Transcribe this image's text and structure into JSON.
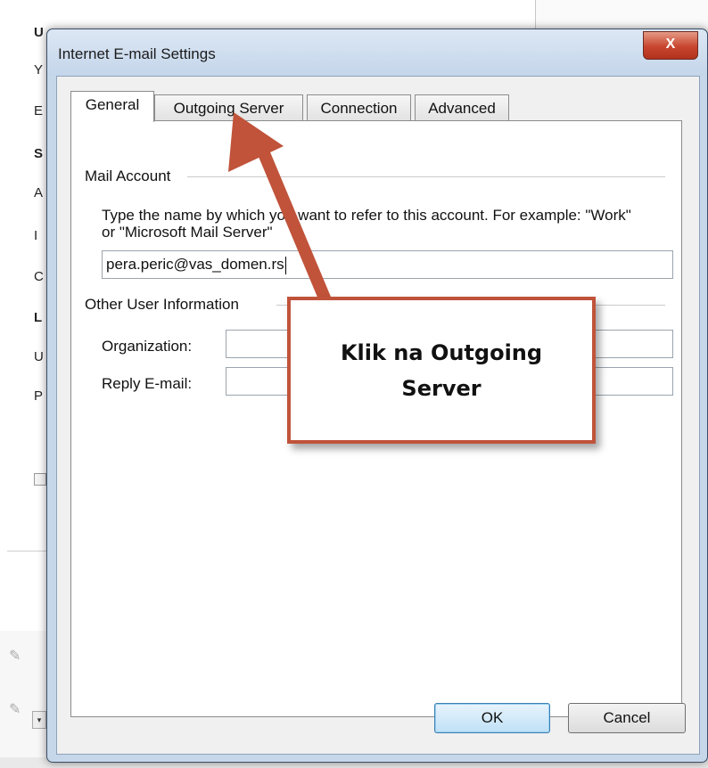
{
  "background_window": {
    "row_initials": [
      "U",
      "Y",
      "E",
      "S",
      "A",
      "I",
      "C",
      "L",
      "U",
      "P"
    ]
  },
  "dialog": {
    "title": "Internet E-mail Settings",
    "close_glyph": "X",
    "tabs": [
      {
        "label": "General",
        "active": true
      },
      {
        "label": "Outgoing Server",
        "active": false
      },
      {
        "label": "Connection",
        "active": false
      },
      {
        "label": "Advanced",
        "active": false
      }
    ],
    "mail_account": {
      "group_label": "Mail Account",
      "description": "Type the name by which you want to refer to this account. For example: \"Work\" or \"Microsoft Mail Server\"",
      "account_name_value": "pera.peric@vas_domen.rs"
    },
    "other_user_info": {
      "group_label": "Other User Information",
      "organization_label": "Organization:",
      "organization_value": "",
      "reply_email_label": "Reply E-mail:",
      "reply_email_value": ""
    },
    "buttons": {
      "ok": "OK",
      "cancel": "Cancel"
    }
  },
  "annotation": {
    "callout_text": "Klik na Outgoing Server",
    "callout_border_color": "#c0533a",
    "arrow_color": "#c0533a"
  }
}
